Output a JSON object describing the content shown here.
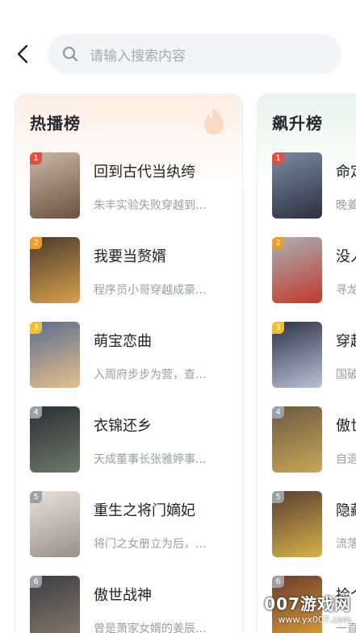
{
  "search": {
    "placeholder": "请输入搜索内容"
  },
  "hot": {
    "title": "热播榜",
    "items": [
      {
        "rank": "1",
        "title": "回到古代当纨绔",
        "desc": "朱丰实验失败穿越到...",
        "cover": [
          "#c9b8a6",
          "#6d5140"
        ],
        "badge": "#f04a3c"
      },
      {
        "rank": "2",
        "title": "我要当赘婿",
        "desc": "程序员小哥穿越成豪...",
        "cover": [
          "#4b3a2e",
          "#d9a14a"
        ],
        "badge": "#f39a2d"
      },
      {
        "rank": "3",
        "title": "萌宝恋曲",
        "desc": "入周府步步为营，查...",
        "cover": [
          "#5b6d8f",
          "#e6c08c"
        ],
        "badge": "#f6c022"
      },
      {
        "rank": "4",
        "title": "衣锦还乡",
        "desc": "天成董事长张雅婷事...",
        "cover": [
          "#2b2f33",
          "#6c7a6a"
        ],
        "badge": "#9aa0a6"
      },
      {
        "rank": "5",
        "title": "重生之将门嫡妃",
        "desc": "将门之女册立为后，...",
        "cover": [
          "#e8e2dc",
          "#9b8f86"
        ],
        "badge": "#9aa0a6"
      },
      {
        "rank": "6",
        "title": "傲世战神",
        "desc": "曾是萧家女婿的姜辰...",
        "cover": [
          "#3a3e45",
          "#8a7b6c"
        ],
        "badge": "#9aa0a6"
      }
    ]
  },
  "rise": {
    "title": "飙升榜",
    "items": [
      {
        "rank": "1",
        "title": "命定",
        "desc": "晚姜",
        "cover": [
          "#7c8aa1",
          "#2a3140"
        ],
        "badge": "#f04a3c"
      },
      {
        "rank": "2",
        "title": "没人",
        "desc": "寻龙",
        "cover": [
          "#a8b0b8",
          "#c33a2a"
        ],
        "badge": "#f39a2d"
      },
      {
        "rank": "3",
        "title": "穿起",
        "desc": "国破",
        "cover": [
          "#2e3346",
          "#b9c2d6"
        ],
        "badge": "#f6c022"
      },
      {
        "rank": "4",
        "title": "傲世",
        "desc": "自退",
        "cover": [
          "#6b5a3f",
          "#c9a75a"
        ],
        "badge": "#9aa0a6"
      },
      {
        "rank": "5",
        "title": "隐藏",
        "desc": "流落",
        "cover": [
          "#5a3d33",
          "#d8b24a"
        ],
        "badge": "#9aa0a6"
      },
      {
        "rank": "6",
        "title": "捡个",
        "desc": "一直",
        "cover": [
          "#6b3a2c",
          "#e0a23a"
        ],
        "badge": "#9aa0a6"
      }
    ]
  },
  "watermark": {
    "main": "007游戏网",
    "url": "www.yx007.com"
  }
}
